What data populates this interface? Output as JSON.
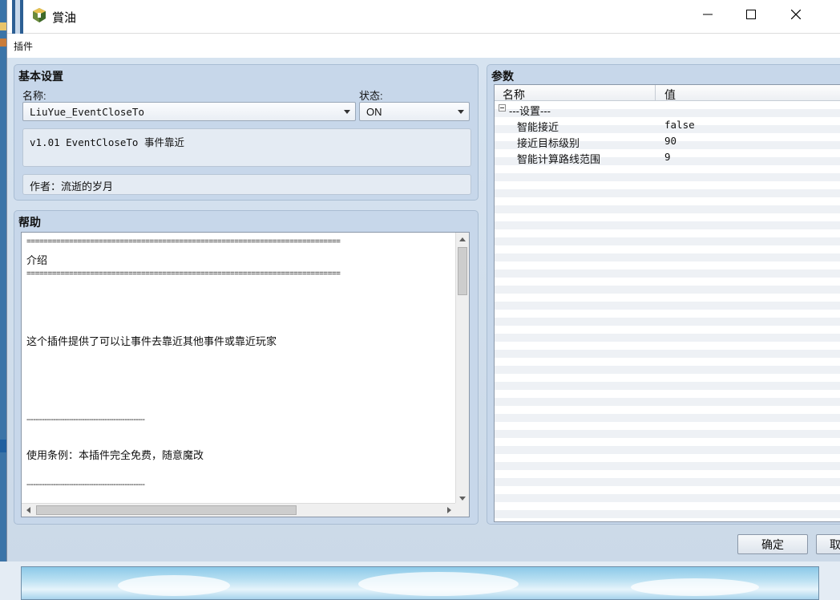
{
  "window": {
    "title": "賞油",
    "controls": {
      "minimize": "minimize-icon",
      "maximize": "maximize-icon",
      "close": "close-icon"
    }
  },
  "menubar": {
    "item": "插件"
  },
  "basic": {
    "title": "基本设置",
    "name_label": "名称:",
    "name_value": "LiuYue_EventCloseTo",
    "status_label": "状态:",
    "status_value": "ON",
    "description": "v1.01 EventCloseTo 事件靠近",
    "author": "作者：流逝的岁月"
  },
  "help": {
    "title": "帮助",
    "lines": [
      "==========================================================================",
      "介绍",
      "==========================================================================",
      "",
      "",
      "",
      "这个插件提供了可以让事件去靠近其他事件或靠近玩家",
      "",
      "",
      "",
      "",
      "-----------------------------------------------------",
      "",
      "使用条例：本插件完全免费，随意魔改",
      "",
      "-----------------------------------------------------"
    ]
  },
  "params": {
    "title": "参数",
    "col_name": "名称",
    "col_value": "值",
    "group": "---设置---",
    "rows": [
      {
        "name": "智能接近",
        "value": "false"
      },
      {
        "name": "接近目标级别",
        "value": "90"
      },
      {
        "name": "智能计算路线范围",
        "value": "9"
      }
    ]
  },
  "buttons": {
    "ok": "确定",
    "cancel": "取"
  }
}
